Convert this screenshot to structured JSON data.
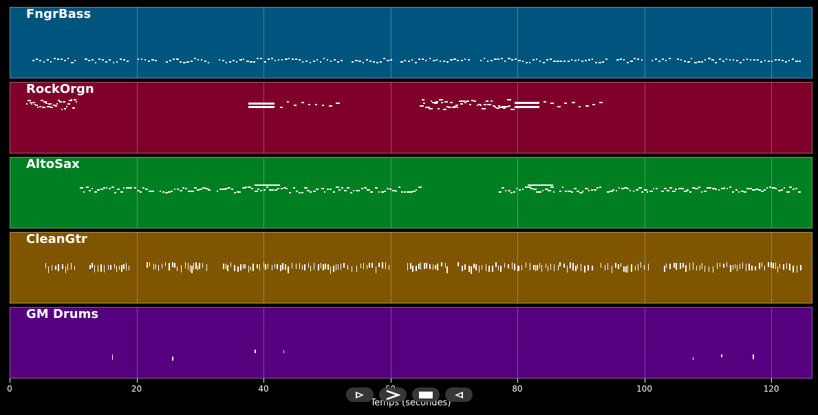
{
  "time_range": [
    0,
    126.5
  ],
  "tracks": [
    {
      "name": "FngrBass",
      "color": "#00557f"
    },
    {
      "name": "RockOrgn",
      "color": "#7f002a"
    },
    {
      "name": "AltoSax",
      "color": "#007f22"
    },
    {
      "name": "CleanGtr",
      "color": "#7f5500"
    },
    {
      "name": "GM Drums",
      "color": "#55007f"
    }
  ],
  "axis": {
    "ticks": [
      "0",
      "20",
      "40",
      "60",
      "80",
      "100",
      "120"
    ],
    "tick_values": [
      0,
      20,
      40,
      60,
      80,
      100,
      120
    ],
    "xlabel": "Temps (secondes)"
  },
  "transport": {
    "buttons": [
      {
        "name": "play-back-button",
        "icon": "play-outline-icon"
      },
      {
        "name": "forward-button",
        "icon": "chevron-right-icon"
      },
      {
        "name": "stop-button",
        "icon": "stop-icon"
      },
      {
        "name": "rewind-button",
        "icon": "play-reverse-icon"
      }
    ]
  }
}
